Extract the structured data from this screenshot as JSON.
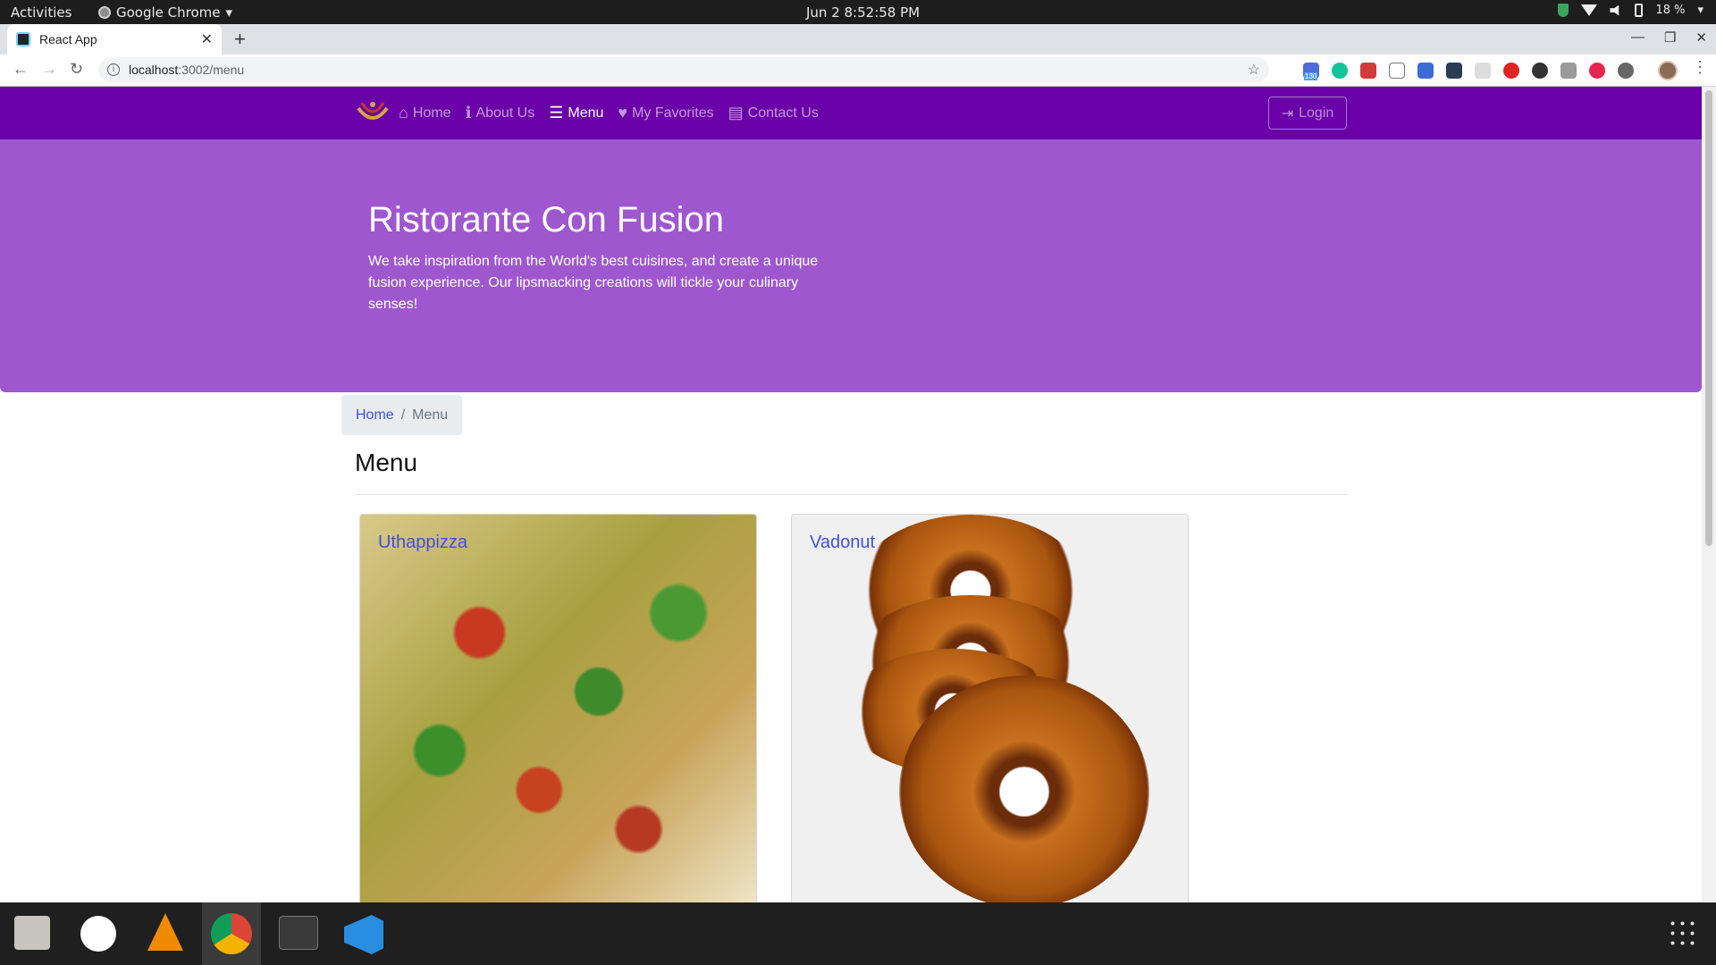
{
  "system": {
    "activities": "Activities",
    "app_name": "Google Chrome",
    "clock": "Jun 2   8:52:58 PM",
    "battery": "18 %"
  },
  "browser": {
    "tab_title": "React App",
    "url_host": "localhost",
    "url_path": ":3002/menu",
    "extension_badge": "130"
  },
  "navbar": {
    "links": [
      {
        "label": "Home",
        "icon": "home-icon"
      },
      {
        "label": "About Us",
        "icon": "info-icon"
      },
      {
        "label": "Menu",
        "icon": "list-icon"
      },
      {
        "label": "My Favorites",
        "icon": "heart-icon"
      },
      {
        "label": "Contact Us",
        "icon": "address-card-icon"
      }
    ],
    "active": "Menu",
    "login_label": "Login"
  },
  "jumbotron": {
    "title": "Ristorante Con Fusion",
    "text": "We take inspiration from the World's best cuisines, and create a unique fusion experience. Our lipsmacking creations will tickle your culinary senses!"
  },
  "breadcrumb": {
    "home": "Home",
    "separator": "/",
    "current": "Menu"
  },
  "page_title": "Menu",
  "dishes": [
    {
      "name": "Uthappizza"
    },
    {
      "name": "Vadonut"
    }
  ],
  "colors": {
    "navbar": "#6a00a8",
    "jumbotron": "#9f57cf",
    "link": "#3f51d8"
  }
}
